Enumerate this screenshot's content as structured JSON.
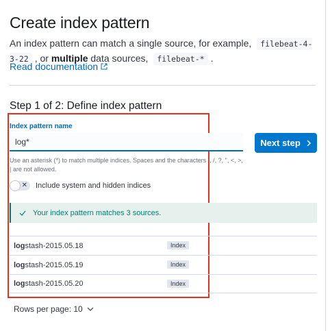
{
  "header": {
    "title": "Create index pattern",
    "desc_prefix": "An index pattern can match a single source, for example,",
    "example_single": "filebeat-4-3-22",
    "desc_or": ", or",
    "desc_multiple": "multiple",
    "desc_middle": " data sources,",
    "example_multi": "filebeat-*",
    "desc_end": ".",
    "doc_link": "Read documentation"
  },
  "step": {
    "title": "Step 1 of 2: Define index pattern",
    "field_label": "Index pattern name",
    "input_value": "log*",
    "next_label": "Next step",
    "help_text": "Use an asterisk (*) to match multiple indices. Spaces and the characters \\, /, ?, \", <, >, | are not allowed.",
    "toggle_label": "Include system and hidden indices",
    "toggle_on": false
  },
  "callout": {
    "text": "Your index pattern matches 3 sources."
  },
  "sources": [
    {
      "match": "log",
      "rest": "stash-2015.05.18",
      "badge": "Index"
    },
    {
      "match": "log",
      "rest": "stash-2015.05.19",
      "badge": "Index"
    },
    {
      "match": "log",
      "rest": "stash-2015.05.20",
      "badge": "Index"
    }
  ],
  "pagination": {
    "rows_per_page": "Rows per page: 10"
  },
  "colors": {
    "accent": "#0077cc",
    "success": "#017d73",
    "highlight": "#e8321c"
  }
}
